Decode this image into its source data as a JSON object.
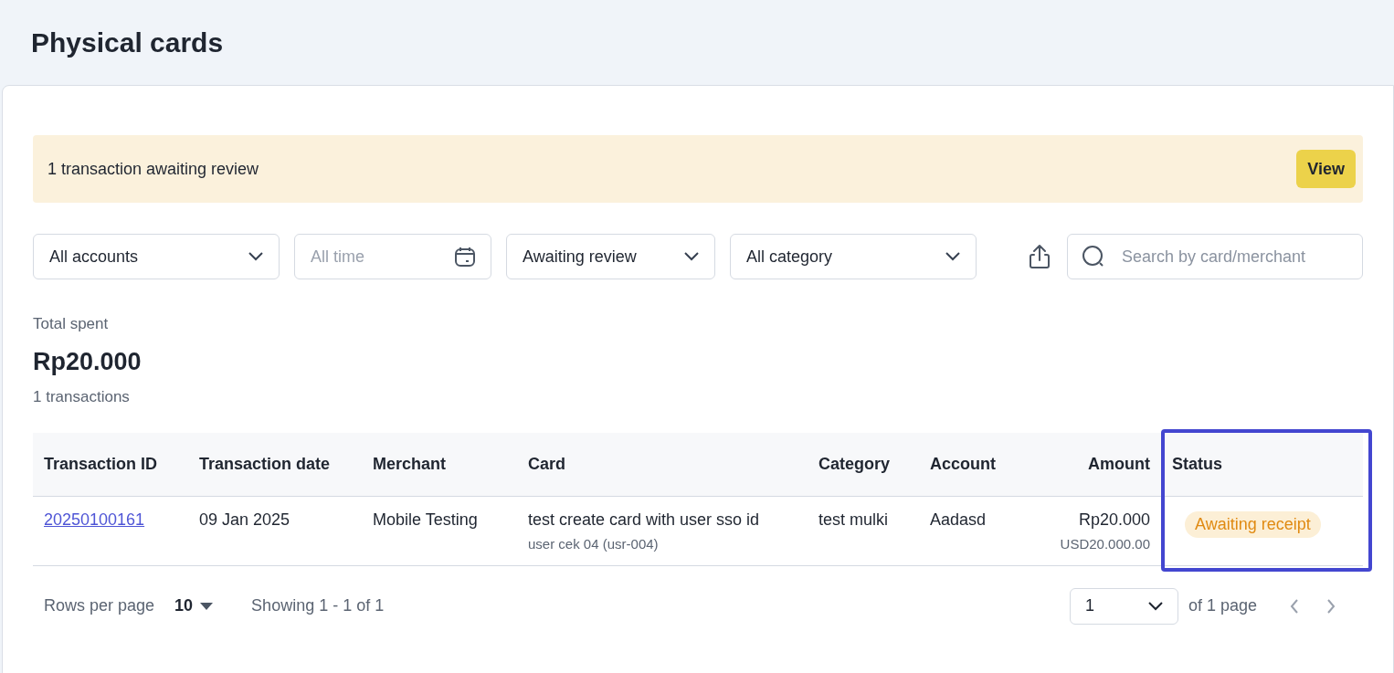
{
  "page": {
    "title": "Physical cards"
  },
  "banner": {
    "message": "1 transaction awaiting review",
    "button": "View"
  },
  "filters": [
    {
      "kind": "select",
      "value": "All accounts"
    },
    {
      "kind": "date",
      "placeholder": "All time"
    },
    {
      "kind": "select",
      "value": "Awaiting review"
    },
    {
      "kind": "select",
      "value": "All category"
    }
  ],
  "search": {
    "placeholder": "Search by card/merchant"
  },
  "summary": {
    "label": "Total spent",
    "total": "Rp20.000",
    "count": "1 transactions"
  },
  "table": {
    "columns": [
      {
        "label": "Transaction ID",
        "kind": "text",
        "highlighted": false
      },
      {
        "label": "Transaction date",
        "kind": "text",
        "highlighted": false
      },
      {
        "label": "Merchant",
        "kind": "text",
        "highlighted": false
      },
      {
        "label": "Card",
        "kind": "text",
        "highlighted": false
      },
      {
        "label": "Category",
        "kind": "text",
        "highlighted": false
      },
      {
        "label": "Account",
        "kind": "text",
        "highlighted": false
      },
      {
        "label": "Amount",
        "kind": "money",
        "highlighted": false
      },
      {
        "label": "Status",
        "kind": "text",
        "highlighted": true
      }
    ],
    "rows": [
      {
        "id": "20250100161",
        "date": "09 Jan 2025",
        "merchant": "Mobile Testing",
        "card": "test create card with user sso id",
        "card_user": "user cek 04 (usr-004)",
        "category": "test mulki",
        "account": "Aadasd",
        "amount": "Rp20.000",
        "amount_usd": "USD20.000.00",
        "status": "Awaiting receipt"
      }
    ]
  },
  "pagination": {
    "rows_label": "Rows per page",
    "rows_value": "10",
    "showing": "Showing 1 - 1 of 1",
    "page": "1",
    "of_pages": "of 1 page"
  }
}
